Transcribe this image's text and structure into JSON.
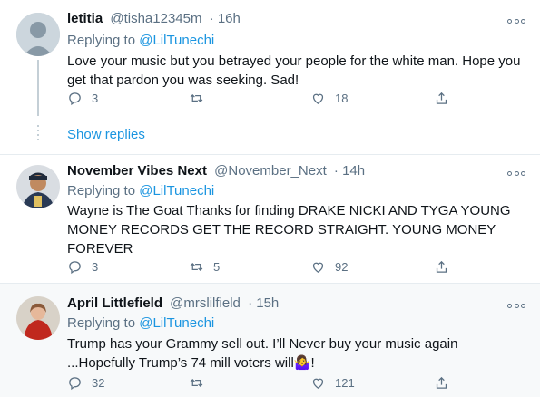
{
  "tweets": [
    {
      "display_name": "letitia",
      "handle": "@tisha12345m",
      "time": "· 16h",
      "replying_prefix": "Replying to",
      "replying_to": "@LilTunechi",
      "text": "Love your music but you betrayed your people for the white man. Hope you get that pardon you was seeking. Sad!",
      "replies": "3",
      "retweets": "",
      "likes": "18",
      "show_replies": "Show replies"
    },
    {
      "display_name": "November Vibes Next",
      "handle": "@November_Next",
      "time": "· 14h",
      "replying_prefix": "Replying to",
      "replying_to": "@LilTunechi",
      "text": "Wayne is The Goat Thanks for finding DRAKE NICKI AND TYGA YOUNG MONEY RECORDS GET THE RECORD STRAIGHT. YOUNG MONEY FOREVER",
      "replies": "3",
      "retweets": "5",
      "likes": "92"
    },
    {
      "display_name": "April Littlefield",
      "handle": "@mrslilfield",
      "time": "· 15h",
      "replying_prefix": "Replying to",
      "replying_to": "@LilTunechi",
      "text_line1": "Trump has your Grammy sell out. I’ll Never buy your music again",
      "text_line2": "...Hopefully Trump’s 74 mill voters will",
      "text_emoji": "🤷‍♀️",
      "text_end": "!",
      "replies": "32",
      "retweets": "",
      "likes": "121"
    }
  ],
  "colors": {
    "accent": "#1b95e0",
    "muted": "#5b7083",
    "text": "#0f1419"
  },
  "icons": [
    "reply-icon",
    "retweet-icon",
    "like-icon",
    "share-icon",
    "more-icon"
  ]
}
